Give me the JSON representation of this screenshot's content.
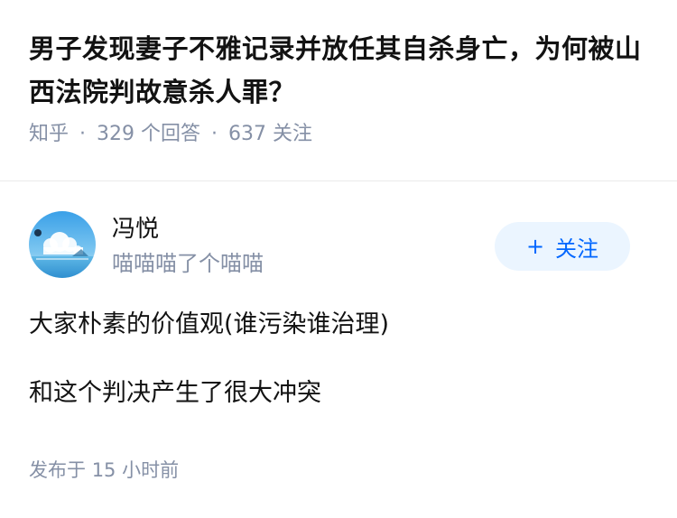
{
  "question": {
    "title": "男子发现妻子不雅记录并放任其自杀身亡，为何被山西法院判故意杀人罪？",
    "source": "知乎",
    "answer_count": "329",
    "answer_label": "个回答",
    "follower_count": "637",
    "follower_label": "关注"
  },
  "author": {
    "name": "冯悦",
    "bio": "喵喵喵了个喵喵",
    "avatar_icon": "avatar-sky-ocean-image"
  },
  "follow_button": {
    "icon": "plus-icon",
    "plus": "+",
    "label": "关注"
  },
  "answer": {
    "paragraphs": [
      "大家朴素的价值观(谁污染谁治理)",
      "和这个判决产生了很大冲突"
    ],
    "published_prefix": "发布于",
    "published_value": "15",
    "published_suffix": "小时前"
  },
  "colors": {
    "accent": "#0066ff",
    "accent_bg": "#ebf5ff",
    "meta_text": "#8590a6",
    "main_text": "#121212"
  }
}
